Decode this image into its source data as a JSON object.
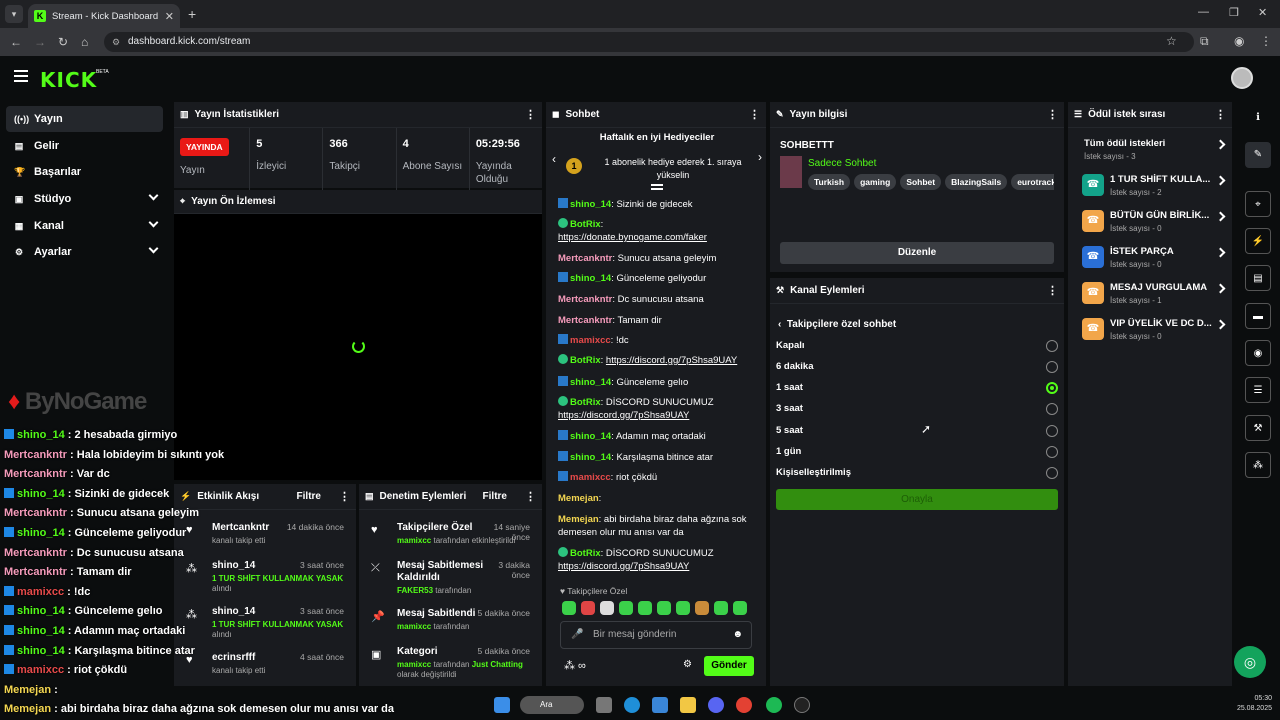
{
  "browser": {
    "tab_title": "Stream - Kick Dashboard",
    "url": "dashboard.kick.com/stream"
  },
  "header": {
    "logo": "KICK",
    "beta": "BETA"
  },
  "leftnav": {
    "items": [
      {
        "label": "Yayın",
        "icon": "broadcast-icon"
      },
      {
        "label": "Gelir",
        "icon": "revenue-icon"
      },
      {
        "label": "Başarılar",
        "icon": "trophy-icon"
      },
      {
        "label": "Stüdyo",
        "icon": "studio-icon"
      },
      {
        "label": "Kanal",
        "icon": "channel-icon"
      },
      {
        "label": "Ayarlar",
        "icon": "gear-icon"
      }
    ]
  },
  "stats_panel": {
    "title": "Yayın İstatistikleri",
    "live_badge": "YAYINDA",
    "status_label": "Yayın",
    "viewers_value": "5",
    "viewers_label": "İzleyici",
    "followers_value": "366",
    "followers_label": "Takipçi",
    "subs_value": "4",
    "subs_label": "Abone Sayısı",
    "uptime_value": "05:29:56",
    "uptime_label": "Yayında Olduğu"
  },
  "preview_panel": {
    "title": "Yayın Ön İzlemesi"
  },
  "overlay": {
    "logo": "ByNoGame",
    "lines": [
      {
        "user": "shino_14",
        "text": " : 2 hesabada girmiyo",
        "color": "#53fc18"
      },
      {
        "user": "Mertcankntr",
        "text": " : Hala lobideyim bi sıkıntı yok",
        "color": "#f59bbb"
      },
      {
        "user": "Mertcankntr",
        "text": " : Var dc",
        "color": "#f59bbb"
      },
      {
        "user": "shino_14",
        "text": " : Sizinki de gidecek",
        "color": "#53fc18"
      },
      {
        "user": "Mertcankntr",
        "text": " : Sunucu atsana geleyim",
        "color": "#f59bbb"
      },
      {
        "user": "shino_14",
        "text": " : Günceleme geliyodur",
        "color": "#53fc18"
      },
      {
        "user": "Mertcankntr",
        "text": " : Dc sunucusu atsana",
        "color": "#f59bbb"
      },
      {
        "user": "Mertcankntr",
        "text": " : Tamam dir",
        "color": "#f59bbb"
      },
      {
        "user": "mamixcc",
        "text": " : !dc",
        "color": "#e64a4a"
      },
      {
        "user": "shino_14",
        "text": " : Günceleme gelıo",
        "color": "#53fc18"
      },
      {
        "user": "shino_14",
        "text": " : Adamın maç ortadaki",
        "color": "#53fc18"
      },
      {
        "user": "shino_14",
        "text": " : Karşılaşma bitince atar",
        "color": "#53fc18"
      },
      {
        "user": "mamixcc",
        "text": " : riot çökdü",
        "color": "#e64a4a"
      },
      {
        "user": "Memejan",
        "text": " :",
        "color": "#f3d651"
      },
      {
        "user": "Memejan",
        "text": " : abi birdaha biraz daha ağzına sok demesen olur mu anısı var da",
        "color": "#f3d651"
      }
    ]
  },
  "activity_panel": {
    "title": "Etkinlik Akışı",
    "filter": "Filtre",
    "items": [
      {
        "name": "Mertcankntr",
        "sub": "kanalı takip etti",
        "time": "14 dakika önce"
      },
      {
        "name": "shino_14",
        "sub_hl": "1 TUR SHİFT KULLANMAK YASAK",
        "sub": "alındı",
        "time": "3 saat önce"
      },
      {
        "name": "shino_14",
        "sub_hl": "1 TUR SHİFT KULLANMAK YASAK",
        "sub": "alındı",
        "time": "3 saat önce"
      },
      {
        "name": "ecrinsrfff",
        "sub": "kanalı takip etti",
        "time": "4 saat önce"
      }
    ]
  },
  "moderation_panel": {
    "title": "Denetim Eylemleri",
    "filter": "Filtre",
    "items": [
      {
        "name": "Takipçilere Özel",
        "user": "mamixcc",
        "sub": " tarafından etkinleştirildi",
        "time": "14 saniye önce"
      },
      {
        "name": "Mesaj Sabitlemesi Kaldırıldı",
        "user": "FAKER53",
        "sub": " tarafından",
        "time": "3 dakika önce"
      },
      {
        "name": "Mesaj Sabitlendi",
        "user": "mamixcc",
        "sub": " tarafından",
        "time": "5 dakika önce"
      },
      {
        "name": "Kategori",
        "user": "mamixcc",
        "sub": " tarafından ",
        "cat": "Just Chatting",
        "sub2": "olarak değiştirildi",
        "time": "5 dakika önce"
      }
    ]
  },
  "chat_panel": {
    "title": "Sohbet",
    "gift_title": "Haftalık en iyi Hediyeciler",
    "gift_rank": "1",
    "gift_sub": "1 abonelik hediye ederek 1. sıraya yükselin",
    "messages": [
      {
        "user": "shino_14",
        "text": ": Sizinki de gidecek"
      },
      {
        "user": "BotRix",
        "text": ":",
        "link": "https://donate.bynogame.com/faker"
      },
      {
        "user": "Mertcankntr",
        "text": ": Sunucu atsana geleyim"
      },
      {
        "user": "shino_14",
        "text": ": Günceleme geliyodur"
      },
      {
        "user": "Mertcankntr",
        "text": ": Dc sunucusu atsana"
      },
      {
        "user": "Mertcankntr",
        "text": ": Tamam dir"
      },
      {
        "user": "mamixcc",
        "text": ": !dc"
      },
      {
        "user": "BotRix",
        "text": ": ",
        "link": "https://discord.gg/7pShsa9UAY"
      },
      {
        "user": "shino_14",
        "text": ": Günceleme gelıo"
      },
      {
        "user": "BotRix",
        "text": ": DİSCORD SUNUCUMUZ",
        "link": "https://discord.gg/7pShsa9UAY"
      },
      {
        "user": "shino_14",
        "text": ": Adamın maç ortadaki"
      },
      {
        "user": "shino_14",
        "text": ": Karşılaşma bitince atar"
      },
      {
        "user": "mamixcc",
        "text": ": riot çökdü"
      },
      {
        "user": "Memejan",
        "text": ":"
      },
      {
        "user": "Memejan",
        "text": ": abi birdaha biraz daha ağzına sok demesen olur mu anısı var da"
      },
      {
        "user": "BotRix",
        "text": ": DİSCORD SUNUCUMUZ",
        "link": "https://discord.gg/7pShsa9UAY"
      }
    ],
    "followers_only_label": "Takipçilere Özel",
    "input_placeholder": "Bir mesaj gönderin",
    "send_label": "Gönder"
  },
  "stream_info": {
    "title": "Yayın bilgisi",
    "stream_title": "SOHBETTT",
    "category": "Sadece Sohbet",
    "tags": [
      "Turkish",
      "gaming",
      "Sohbet",
      "BlazingSails",
      "eurotracksim"
    ],
    "edit_label": "Düzenle"
  },
  "channel_actions": {
    "title": "Kanal Eylemleri",
    "back_label": "Takipçilere özel sohbet",
    "options": [
      "Kapalı",
      "6 dakika",
      "1 saat",
      "3 saat",
      "5 saat",
      "1 gün",
      "Kişiselleştirilmiş"
    ],
    "selected": "1 saat",
    "apply_label": "Onayla"
  },
  "rewards": {
    "title": "Ödül istek sırası",
    "all_label": "Tüm ödül istekleri",
    "all_sub": "İstek sayısı - 3",
    "items": [
      {
        "name": "1 TUR SHİFT KULLA...",
        "sub": "İstek sayısı - 2",
        "color": "#13a38a"
      },
      {
        "name": "BÜTÜN GÜN BİRLİK...",
        "sub": "İstek sayısı - 0",
        "color": "#f2a64a"
      },
      {
        "name": "İSTEK PARÇA",
        "sub": "İstek sayısı - 0",
        "color": "#2a6fd6"
      },
      {
        "name": "MESAJ VURGULAMA",
        "sub": "İstek sayısı - 1",
        "color": "#f2a64a"
      },
      {
        "name": "VIP ÜYELİK VE DC D...",
        "sub": "İstek sayısı - 0",
        "color": "#f2a64a"
      }
    ]
  },
  "taskbar": {
    "search": "Ara",
    "time": "05:30",
    "date": "25.08.2025"
  }
}
